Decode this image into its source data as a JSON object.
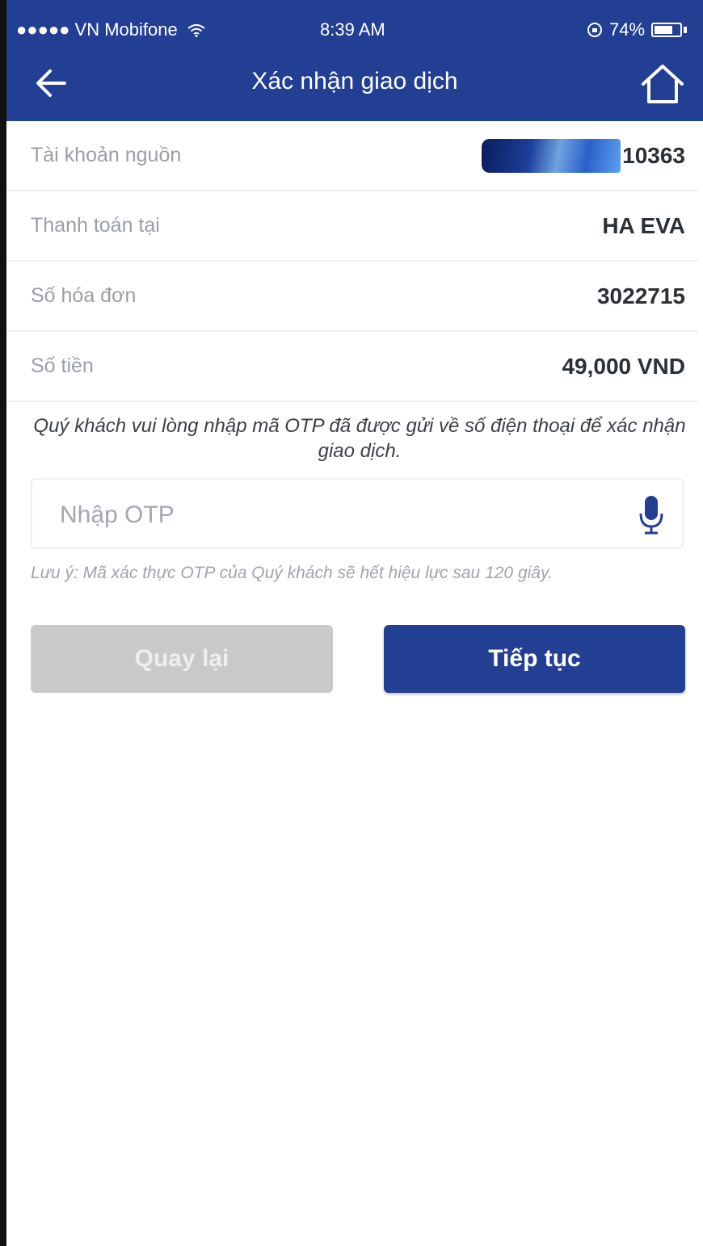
{
  "status_bar": {
    "carrier": "●●●●● VN Mobifone",
    "time": "8:39 AM",
    "battery_percent": "74%",
    "battery_level": 0.74
  },
  "nav": {
    "title": "Xác nhận giao dịch",
    "back_icon": "arrow-left-icon",
    "home_icon": "home-icon"
  },
  "details": [
    {
      "label": "Tài khoản nguồn",
      "value": "10363"
    },
    {
      "label": "Thanh toán tại",
      "value": "HA EVA"
    },
    {
      "label": "Số hóa đơn",
      "value": "3022715"
    },
    {
      "label": "Số tiền",
      "value": "49,000 VND"
    }
  ],
  "otp": {
    "instruction": "Quý khách vui lòng nhập mã OTP đã được gửi về số điện thoại để xác nhận giao dịch.",
    "placeholder": "Nhập OTP",
    "value": "",
    "mic_icon": "microphone-icon",
    "note": "Lưu ý: Mã xác thực OTP của Quý khách sẽ hết hiệu lực sau 120 giây."
  },
  "buttons": {
    "back_label": "Quay lại",
    "next_label": "Tiếp tục"
  },
  "colors": {
    "primary": "#233f94",
    "disabled_button": "#c8c9cb",
    "label_gray": "#9a9ea6"
  }
}
